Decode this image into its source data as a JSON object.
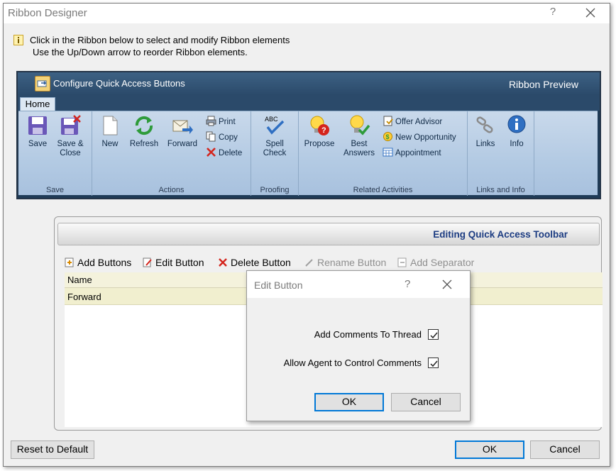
{
  "window": {
    "title": "Ribbon Designer",
    "help_glyph": "?",
    "info_line1": "Click in the Ribbon below to select and modify Ribbon elements",
    "info_line2": "Use the Up/Down arrow to reorder Ribbon elements."
  },
  "ribbon": {
    "quick_access_label": "Configure Quick Access Buttons",
    "preview_label": "Ribbon Preview",
    "tab": "Home",
    "groups": {
      "save": {
        "label": "Save",
        "buttons": [
          "Save",
          "Save &",
          "Close"
        ]
      },
      "actions": {
        "label": "Actions",
        "big": [
          "New",
          "Refresh",
          "Forward"
        ],
        "small": [
          "Print",
          "Copy",
          "Delete"
        ]
      },
      "proofing": {
        "label": "Proofing",
        "abc": "ABC",
        "button_line1": "Spell",
        "button_line2": "Check"
      },
      "related": {
        "label": "Related Activities",
        "propose": "Propose",
        "best_line1": "Best",
        "best_line2": "Answers",
        "small": [
          "Offer Advisor",
          "New Opportunity",
          "Appointment"
        ]
      },
      "links": {
        "label": "Links and Info",
        "links": "Links",
        "info": "Info"
      }
    }
  },
  "qa_panel": {
    "title": "Editing Quick Access Toolbar",
    "toolbar": {
      "add": "Add Buttons",
      "edit": "Edit Button",
      "delete": "Delete Button",
      "rename": "Rename Button",
      "separator": "Add Separator"
    },
    "list": {
      "column": "Name",
      "rows": [
        "Forward"
      ]
    }
  },
  "edit_dialog": {
    "title": "Edit Button",
    "help_glyph": "?",
    "option1": "Add Comments To Thread",
    "option1_checked": true,
    "option2": "Allow Agent to Control Comments",
    "option2_checked": true,
    "ok": "OK",
    "cancel": "Cancel"
  },
  "footer": {
    "reset": "Reset to Default",
    "ok": "OK",
    "cancel": "Cancel"
  },
  "colors": {
    "ribbon_dark": "#2b4a6a",
    "ribbon_body": "#b3cae3",
    "qa_title": "#1c3c82",
    "focus_blue": "#0078d7",
    "list_selected": "#f1efcf"
  }
}
